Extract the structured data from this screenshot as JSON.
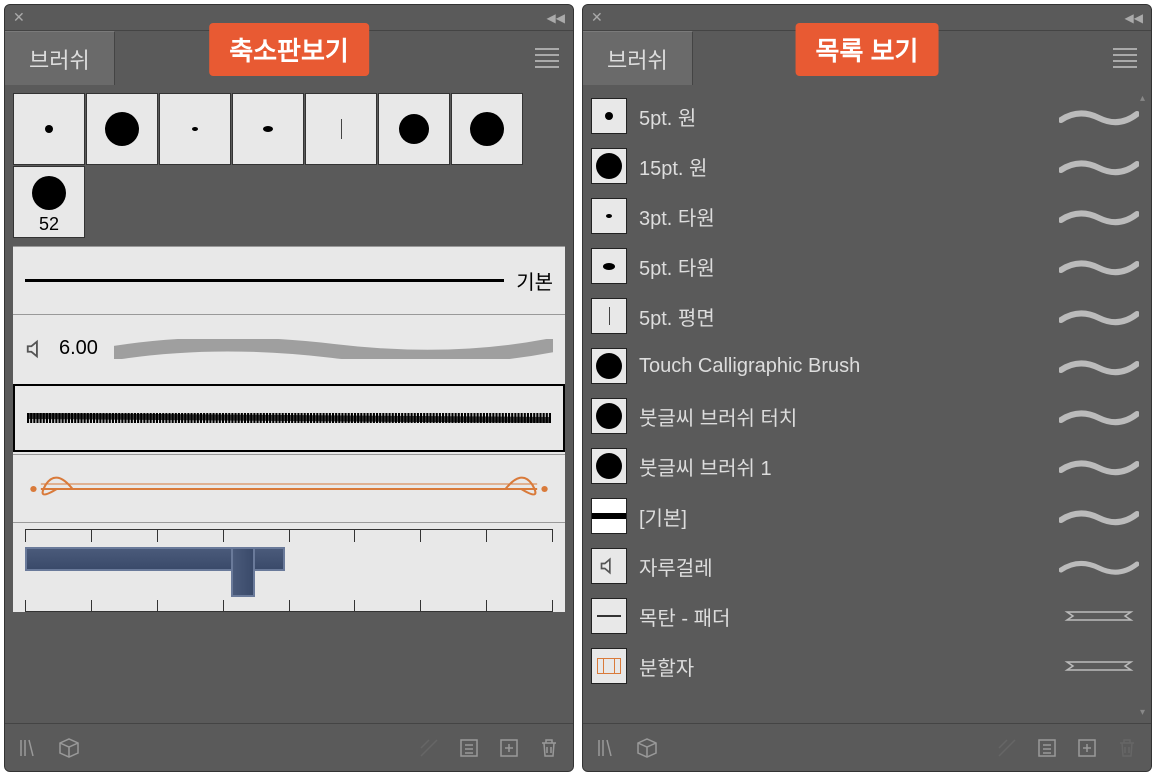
{
  "left_panel": {
    "caption": "축소판보기",
    "tab_label": "브러쉬",
    "thumbnails": {
      "numbered_label": "52"
    },
    "previews": {
      "basic_label": "기본",
      "calligraphic_size": "6.00"
    }
  },
  "right_panel": {
    "caption": "목록 보기",
    "tab_label": "브러쉬",
    "items": [
      {
        "label": "5pt. 원",
        "icon": "dot-sm"
      },
      {
        "label": "15pt. 원",
        "icon": "dot-lg"
      },
      {
        "label": "3pt. 타원",
        "icon": "dot-xs"
      },
      {
        "label": "5pt. 타원",
        "icon": "dot-oval"
      },
      {
        "label": "5pt. 평면",
        "icon": "line-v"
      },
      {
        "label": "Touch Calligraphic Brush",
        "icon": "dot-lg"
      },
      {
        "label": "붓글씨 브러쉬 터치",
        "icon": "dot-lg"
      },
      {
        "label": "붓글씨 브러쉬 1",
        "icon": "dot-lg"
      },
      {
        "label": "[기본]",
        "icon": "bar"
      },
      {
        "label": "자루걸레",
        "icon": "speaker",
        "stroke": "wavy"
      },
      {
        "label": "목탄 - 패더",
        "icon": "bar-mid",
        "stroke": "banner"
      },
      {
        "label": "분할자",
        "icon": "box-split",
        "stroke": "banner"
      }
    ]
  }
}
